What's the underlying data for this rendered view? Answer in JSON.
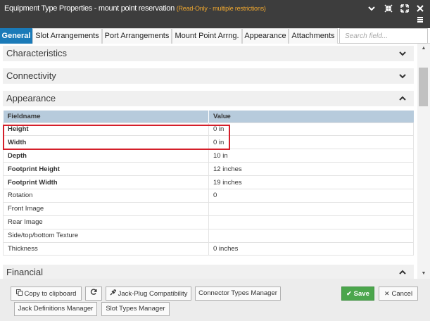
{
  "window": {
    "title": "Equipment Type Properties - mount point reservation",
    "subtitle": "(Read-Only - multiple restrictions)"
  },
  "tabs": [
    {
      "label": "General",
      "active": true
    },
    {
      "label": "Slot Arrangements",
      "active": false
    },
    {
      "label": "Port Arrangements",
      "active": false
    },
    {
      "label": "Mount Point Arrng.",
      "active": false
    },
    {
      "label": "Appearance",
      "active": false
    },
    {
      "label": "Attachments",
      "active": false
    }
  ],
  "search": {
    "placeholder": "Search field..."
  },
  "sections": {
    "characteristics": {
      "label": "Characteristics",
      "expanded": false
    },
    "connectivity": {
      "label": "Connectivity",
      "expanded": false
    },
    "appearance": {
      "label": "Appearance",
      "expanded": true
    },
    "financial": {
      "label": "Financial",
      "expanded": true
    }
  },
  "table": {
    "headers": [
      "Fieldname",
      "Value"
    ],
    "rows": [
      {
        "field": "Height",
        "value": "0 in"
      },
      {
        "field": "Width",
        "value": "0 in"
      },
      {
        "field": "Depth",
        "value": "10 in"
      },
      {
        "field": "Footprint Height",
        "value": "12 inches"
      },
      {
        "field": "Footprint Width",
        "value": "19 inches"
      },
      {
        "field": "Rotation",
        "value": "0"
      },
      {
        "field": "Front Image",
        "value": ""
      },
      {
        "field": "Rear Image",
        "value": ""
      },
      {
        "field": "Side/top/bottom Texture",
        "value": ""
      },
      {
        "field": "Thickness",
        "value": "0 inches"
      }
    ]
  },
  "footer": {
    "copy_label": "Copy to clipboard",
    "jack_plug_label": "Jack-Plug Compatibility",
    "connector_label": "Connector Types Manager",
    "save_label": "Save",
    "cancel_label": "Cancel",
    "jack_def_label": "Jack Definitions Manager",
    "slot_types_label": "Slot Types Manager"
  },
  "colors": {
    "title_bar": "#3d3d3d",
    "read_only_accent": "#f0a830",
    "active_tab": "#1a7ab8",
    "table_header": "#b7cbdc",
    "highlight_box": "#d41f2a",
    "save_button": "#4ba64c"
  },
  "icons": {
    "window_controls": [
      "chevron-down-icon",
      "collapse-icon",
      "expand-icon",
      "close-icon",
      "menu-icon"
    ],
    "copy": "copy-icon",
    "refresh": "refresh-icon",
    "jack_plug": "plug-icon",
    "save": "check-icon",
    "cancel": "close-icon"
  }
}
